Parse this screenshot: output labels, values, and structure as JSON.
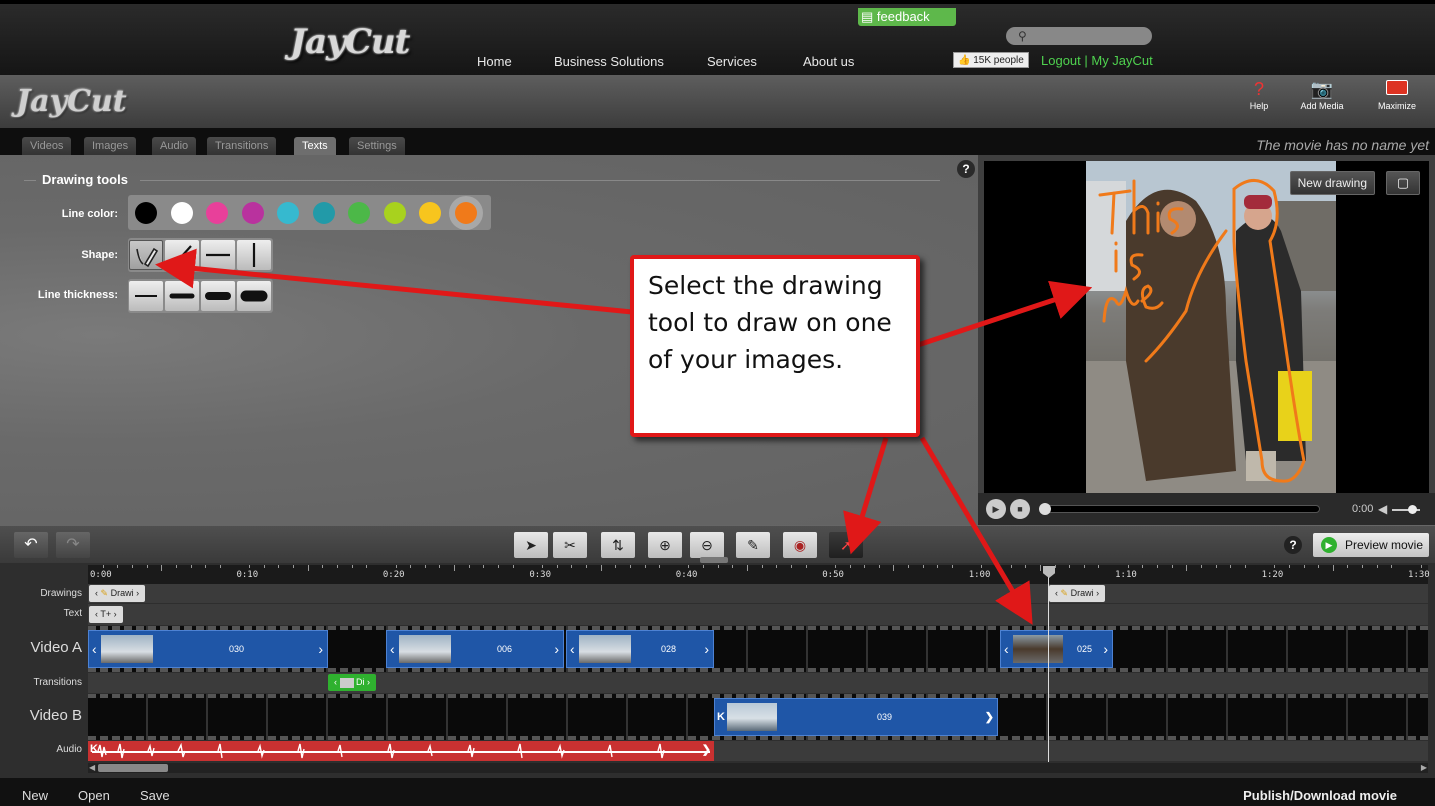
{
  "site": {
    "logo_text": "JayCut",
    "feedback": "feedback",
    "nav": [
      "Home",
      "Business Solutions",
      "Services",
      "About us"
    ],
    "like_label": "15K people",
    "account_links": "Logout | My JayCut"
  },
  "editor": {
    "logo_text": "JayCut",
    "header_buttons": [
      {
        "label": "Help",
        "icon": "question-icon"
      },
      {
        "label": "Add Media",
        "icon": "camera-add-icon"
      },
      {
        "label": "Maximize",
        "icon": "maximize-icon"
      }
    ],
    "tabs": [
      "Videos",
      "Images",
      "Audio",
      "Transitions",
      "Texts",
      "Settings"
    ],
    "active_tab": "Texts",
    "movie_name": "The movie has no name yet"
  },
  "drawing_tools": {
    "title": "Drawing tools",
    "line_color_label": "Line color:",
    "shape_label": "Shape:",
    "line_thickness_label": "Line thickness:",
    "colors": [
      "#000000",
      "#ffffff",
      "#e8409a",
      "#b9329e",
      "#36b9cf",
      "#229aa8",
      "#4cb848",
      "#a8d21e",
      "#f7c51e",
      "#f07a1a"
    ],
    "selected_color": "#f07a1a",
    "shapes": [
      "freehand-pencil-icon",
      "diagonal-line-icon",
      "horizontal-line-icon",
      "vertical-line-icon"
    ],
    "thickness_levels": 4
  },
  "preview": {
    "new_drawing": "New drawing",
    "drawn_text": "This is me",
    "time": "0:00"
  },
  "toolbar": {
    "tools": [
      "select-arrow-icon",
      "cut-icon",
      "split-icon",
      "zoom-in-icon",
      "zoom-out-icon",
      "pencil-icon",
      "record-icon",
      "draw-icon"
    ],
    "preview_movie": "Preview movie",
    "help": "?"
  },
  "timeline": {
    "ruler": [
      "0:00",
      "0:10",
      "0:20",
      "0:30",
      "0:40",
      "0:50",
      "1:00",
      "1:10",
      "1:20",
      "1:30"
    ],
    "tracks": {
      "drawings": "Drawings",
      "text": "Text",
      "video_a": "Video A",
      "transitions": "Transitions",
      "video_b": "Video B",
      "audio": "Audio"
    },
    "drawing_chip": "Drawi",
    "text_chip": "T+",
    "transition_chip": "Di",
    "clips_a": [
      "030",
      "006",
      "028",
      "025"
    ],
    "clip_b": "039"
  },
  "bottom": {
    "new": "New",
    "open": "Open",
    "save": "Save",
    "publish": "Publish/Download movie"
  },
  "callout": {
    "text": "Select the drawing tool to draw on one of your images."
  },
  "accent": {
    "callout_red": "#e01818",
    "clip_blue": "#1f56a7",
    "audio_red": "#c93131"
  }
}
